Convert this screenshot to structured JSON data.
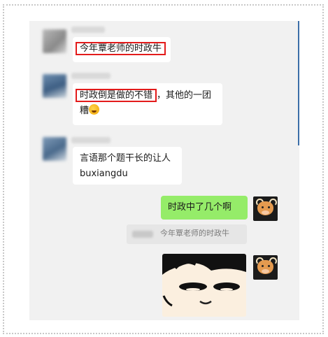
{
  "messages": [
    {
      "side": "left",
      "text": "今年覃老师的时政牛",
      "highlight": "今年覃老师的时政牛"
    },
    {
      "side": "left",
      "highlight": "时政倒是做的不错",
      "text_rest": "，其他的一团",
      "line2": "糟",
      "emoji": "laughing-crying-emoji"
    },
    {
      "side": "left",
      "line1": "言语那个题干长的让人",
      "line2": "buxiangdu"
    },
    {
      "side": "right",
      "text": "时政中了几个啊"
    },
    {
      "side": "right",
      "quote": "今年覃老师的时政牛"
    },
    {
      "side": "right",
      "sticker": "crayon-shin-chan-face-sticker"
    }
  ],
  "colors": {
    "highlight_border": "#e31b1b",
    "bubble_green": "#95ec69",
    "chat_bg": "#f1f1f1"
  }
}
